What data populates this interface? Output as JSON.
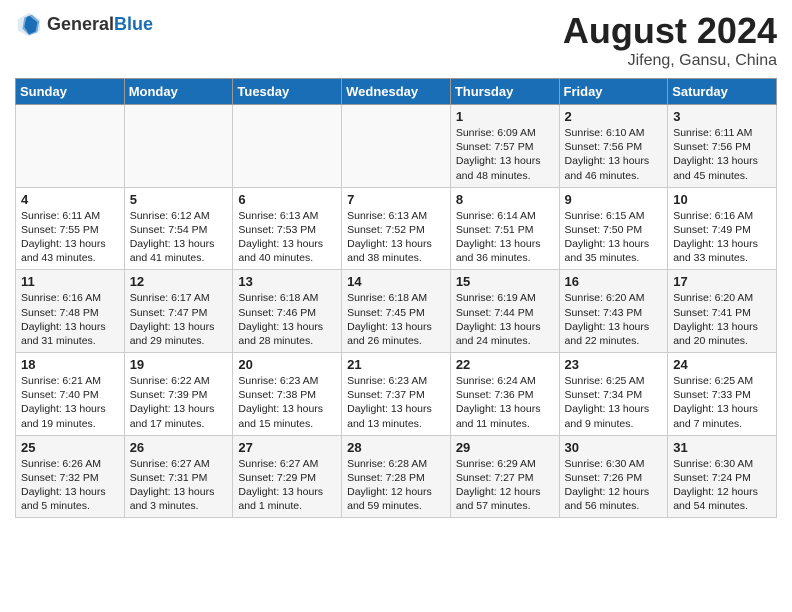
{
  "header": {
    "logo_general": "General",
    "logo_blue": "Blue",
    "month_year": "August 2024",
    "location": "Jifeng, Gansu, China"
  },
  "days_of_week": [
    "Sunday",
    "Monday",
    "Tuesday",
    "Wednesday",
    "Thursday",
    "Friday",
    "Saturday"
  ],
  "weeks": [
    [
      {
        "day": "",
        "info": ""
      },
      {
        "day": "",
        "info": ""
      },
      {
        "day": "",
        "info": ""
      },
      {
        "day": "",
        "info": ""
      },
      {
        "day": "1",
        "info": "Sunrise: 6:09 AM\nSunset: 7:57 PM\nDaylight: 13 hours and 48 minutes."
      },
      {
        "day": "2",
        "info": "Sunrise: 6:10 AM\nSunset: 7:56 PM\nDaylight: 13 hours and 46 minutes."
      },
      {
        "day": "3",
        "info": "Sunrise: 6:11 AM\nSunset: 7:56 PM\nDaylight: 13 hours and 45 minutes."
      }
    ],
    [
      {
        "day": "4",
        "info": "Sunrise: 6:11 AM\nSunset: 7:55 PM\nDaylight: 13 hours and 43 minutes."
      },
      {
        "day": "5",
        "info": "Sunrise: 6:12 AM\nSunset: 7:54 PM\nDaylight: 13 hours and 41 minutes."
      },
      {
        "day": "6",
        "info": "Sunrise: 6:13 AM\nSunset: 7:53 PM\nDaylight: 13 hours and 40 minutes."
      },
      {
        "day": "7",
        "info": "Sunrise: 6:13 AM\nSunset: 7:52 PM\nDaylight: 13 hours and 38 minutes."
      },
      {
        "day": "8",
        "info": "Sunrise: 6:14 AM\nSunset: 7:51 PM\nDaylight: 13 hours and 36 minutes."
      },
      {
        "day": "9",
        "info": "Sunrise: 6:15 AM\nSunset: 7:50 PM\nDaylight: 13 hours and 35 minutes."
      },
      {
        "day": "10",
        "info": "Sunrise: 6:16 AM\nSunset: 7:49 PM\nDaylight: 13 hours and 33 minutes."
      }
    ],
    [
      {
        "day": "11",
        "info": "Sunrise: 6:16 AM\nSunset: 7:48 PM\nDaylight: 13 hours and 31 minutes."
      },
      {
        "day": "12",
        "info": "Sunrise: 6:17 AM\nSunset: 7:47 PM\nDaylight: 13 hours and 29 minutes."
      },
      {
        "day": "13",
        "info": "Sunrise: 6:18 AM\nSunset: 7:46 PM\nDaylight: 13 hours and 28 minutes."
      },
      {
        "day": "14",
        "info": "Sunrise: 6:18 AM\nSunset: 7:45 PM\nDaylight: 13 hours and 26 minutes."
      },
      {
        "day": "15",
        "info": "Sunrise: 6:19 AM\nSunset: 7:44 PM\nDaylight: 13 hours and 24 minutes."
      },
      {
        "day": "16",
        "info": "Sunrise: 6:20 AM\nSunset: 7:43 PM\nDaylight: 13 hours and 22 minutes."
      },
      {
        "day": "17",
        "info": "Sunrise: 6:20 AM\nSunset: 7:41 PM\nDaylight: 13 hours and 20 minutes."
      }
    ],
    [
      {
        "day": "18",
        "info": "Sunrise: 6:21 AM\nSunset: 7:40 PM\nDaylight: 13 hours and 19 minutes."
      },
      {
        "day": "19",
        "info": "Sunrise: 6:22 AM\nSunset: 7:39 PM\nDaylight: 13 hours and 17 minutes."
      },
      {
        "day": "20",
        "info": "Sunrise: 6:23 AM\nSunset: 7:38 PM\nDaylight: 13 hours and 15 minutes."
      },
      {
        "day": "21",
        "info": "Sunrise: 6:23 AM\nSunset: 7:37 PM\nDaylight: 13 hours and 13 minutes."
      },
      {
        "day": "22",
        "info": "Sunrise: 6:24 AM\nSunset: 7:36 PM\nDaylight: 13 hours and 11 minutes."
      },
      {
        "day": "23",
        "info": "Sunrise: 6:25 AM\nSunset: 7:34 PM\nDaylight: 13 hours and 9 minutes."
      },
      {
        "day": "24",
        "info": "Sunrise: 6:25 AM\nSunset: 7:33 PM\nDaylight: 13 hours and 7 minutes."
      }
    ],
    [
      {
        "day": "25",
        "info": "Sunrise: 6:26 AM\nSunset: 7:32 PM\nDaylight: 13 hours and 5 minutes."
      },
      {
        "day": "26",
        "info": "Sunrise: 6:27 AM\nSunset: 7:31 PM\nDaylight: 13 hours and 3 minutes."
      },
      {
        "day": "27",
        "info": "Sunrise: 6:27 AM\nSunset: 7:29 PM\nDaylight: 13 hours and 1 minute."
      },
      {
        "day": "28",
        "info": "Sunrise: 6:28 AM\nSunset: 7:28 PM\nDaylight: 12 hours and 59 minutes."
      },
      {
        "day": "29",
        "info": "Sunrise: 6:29 AM\nSunset: 7:27 PM\nDaylight: 12 hours and 57 minutes."
      },
      {
        "day": "30",
        "info": "Sunrise: 6:30 AM\nSunset: 7:26 PM\nDaylight: 12 hours and 56 minutes."
      },
      {
        "day": "31",
        "info": "Sunrise: 6:30 AM\nSunset: 7:24 PM\nDaylight: 12 hours and 54 minutes."
      }
    ]
  ]
}
